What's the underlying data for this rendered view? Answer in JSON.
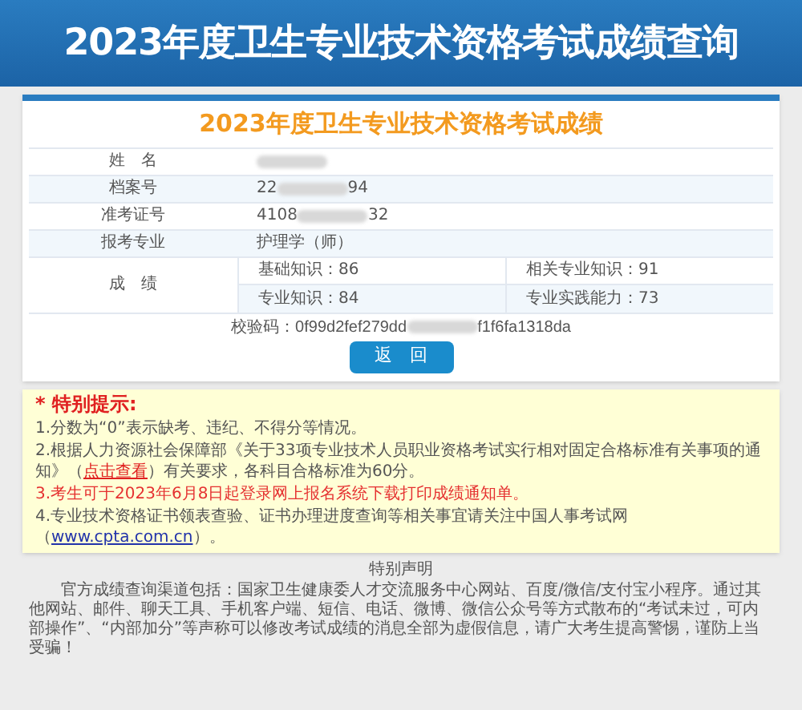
{
  "header": {
    "title": "2023年度卫生专业技术资格考试成绩查询"
  },
  "card": {
    "title": "2023年度卫生专业技术资格考试成绩",
    "rows": [
      {
        "label": "姓　名",
        "parts": [
          {
            "kind": "redacted"
          }
        ]
      },
      {
        "label": "档案号",
        "parts": [
          {
            "kind": "text",
            "text": "22"
          },
          {
            "kind": "redacted"
          },
          {
            "kind": "text",
            "text": "94"
          }
        ]
      },
      {
        "label": "准考证号",
        "parts": [
          {
            "kind": "text",
            "text": "4108"
          },
          {
            "kind": "redacted"
          },
          {
            "kind": "text",
            "text": "32"
          }
        ]
      },
      {
        "label": "报考专业",
        "parts": [
          {
            "kind": "text",
            "text": "护理学（师）"
          }
        ]
      }
    ],
    "scores": {
      "label": "成　绩",
      "items": [
        "基础知识：86",
        "相关专业知识：91",
        "专业知识：84",
        "专业实践能力：73"
      ]
    },
    "verification": {
      "prefix": "校验码：0f99d2fef279dd",
      "suffix": "f1f6fa1318da"
    },
    "button": "返　回"
  },
  "notice": {
    "title": "* 特别提示:",
    "items": [
      {
        "kind": "plain",
        "parts": [
          {
            "kind": "text",
            "text": "1.分数为“0”表示缺考、违纪、不得分等情况。"
          }
        ]
      },
      {
        "kind": "plain",
        "parts": [
          {
            "kind": "text",
            "text": "2.根据人力资源社会保障部《关于33项专业技术人员职业资格考试实行相对固定合格标准有关事项的通知》（"
          },
          {
            "kind": "link",
            "text": "点击查看"
          },
          {
            "kind": "text",
            "text": "）有关要求，各科目合格标准为60分。"
          }
        ]
      },
      {
        "kind": "alert",
        "parts": [
          {
            "kind": "text",
            "text": "3.考生可于2023年6月8日起登录网上报名系统下载打印成绩通知单。"
          }
        ]
      },
      {
        "kind": "plain",
        "parts": [
          {
            "kind": "text",
            "text": "4.专业技术资格证书领表查验、证书办理进度查询等相关事宜请关注中国人事考试网（"
          },
          {
            "kind": "url",
            "text": "www.cpta.com.cn"
          },
          {
            "kind": "text",
            "text": "）。"
          }
        ]
      }
    ]
  },
  "statement": {
    "title": "特别声明",
    "body": "官方成绩查询渠道包括：国家卫生健康委人才交流服务中心网站、百度/微信/支付宝小程序。通过其他网站、邮件、聊天工具、手机客户端、短信、电话、微博、微信公众号等方式散布的“考试未过，可内部操作”、“内部加分”等声称可以修改考试成绩的消息全部为虚假信息，请广大考生提高警惕，谨防上当受骗！"
  }
}
